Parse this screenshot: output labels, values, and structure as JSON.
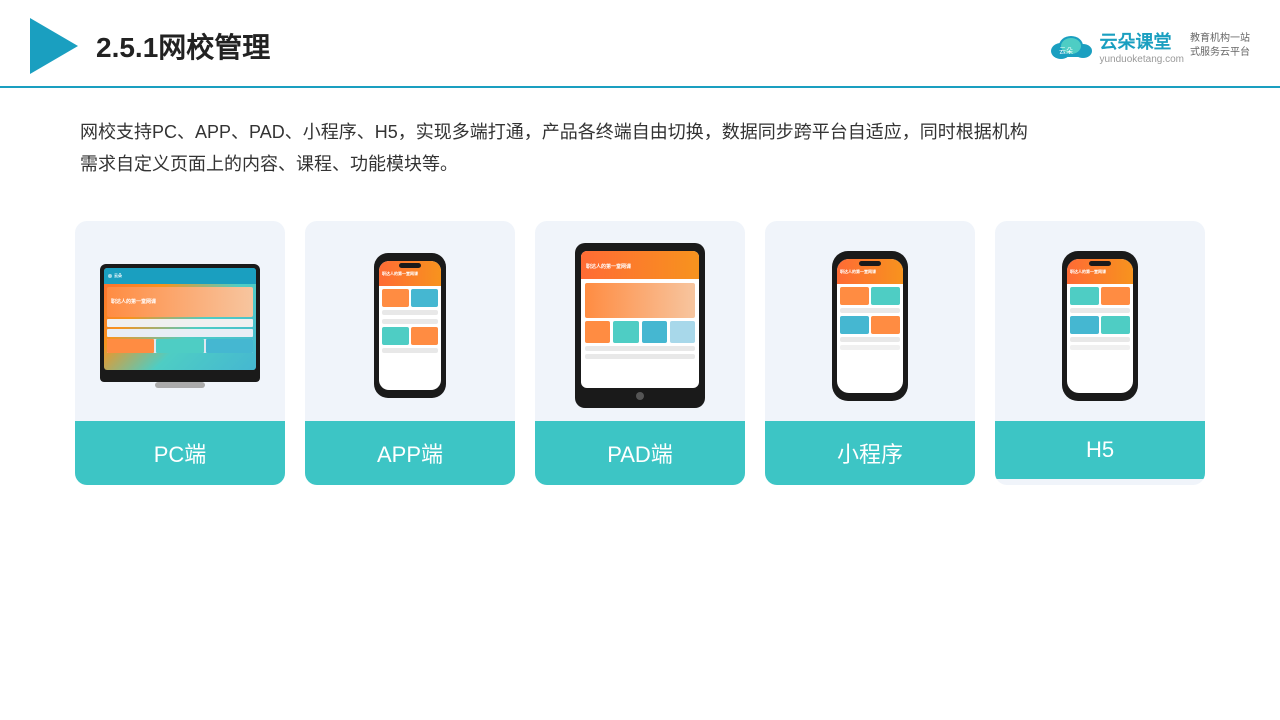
{
  "header": {
    "title": "2.5.1网校管理",
    "logo": {
      "name": "云朵课堂",
      "url": "yunduoketang.com",
      "subtitle1": "教育机构一站",
      "subtitle2": "式服务云平台"
    }
  },
  "description": {
    "line1": "网校支持PC、APP、PAD、小程序、H5，实现多端打通，产品各终端自由切换，数据同步跨平台自适应，同时根据机构",
    "line2": "需求自定义页面上的内容、课程、功能模块等。"
  },
  "cards": [
    {
      "id": "pc",
      "label": "PC端"
    },
    {
      "id": "app",
      "label": "APP端"
    },
    {
      "id": "pad",
      "label": "PAD端"
    },
    {
      "id": "miniapp",
      "label": "小程序"
    },
    {
      "id": "h5",
      "label": "H5"
    }
  ]
}
